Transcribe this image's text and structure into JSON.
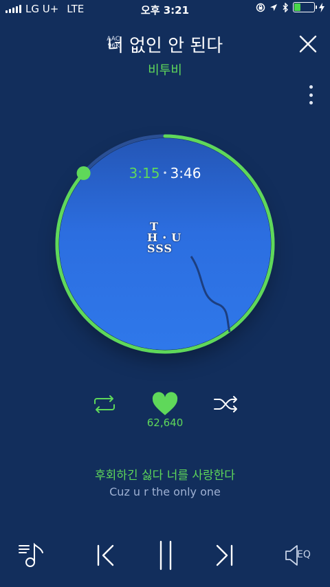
{
  "status_bar": {
    "carrier": "LG U+",
    "network": "LTE",
    "time": "오후 3:21"
  },
  "header": {
    "codec_line1": "AAC",
    "codec_line2": "96K",
    "title": "너 없인 안 된다",
    "artist": "비투비"
  },
  "player": {
    "current_time": "3:15",
    "separator": "•",
    "total_time": "3:46",
    "progress_fraction": 0.864,
    "like_count": "62,640",
    "cover_text_lines": [
      "T",
      "H ꞏ U",
      "SSS"
    ]
  },
  "lyrics": {
    "current": "후회하긴 싫다 너를 사랑한다",
    "next": "Cuz u r the only one"
  },
  "bottom_bar": {
    "eq_label": "EQ"
  },
  "colors": {
    "background": "#122e5c",
    "accent_green": "#5fd85a",
    "disc_blue": "#2c6ee0"
  },
  "icons": [
    "close-icon",
    "more-vertical-icon",
    "repeat-icon",
    "heart-icon",
    "shuffle-icon",
    "playlist-icon",
    "previous-icon",
    "pause-icon",
    "next-icon",
    "speaker-icon"
  ]
}
